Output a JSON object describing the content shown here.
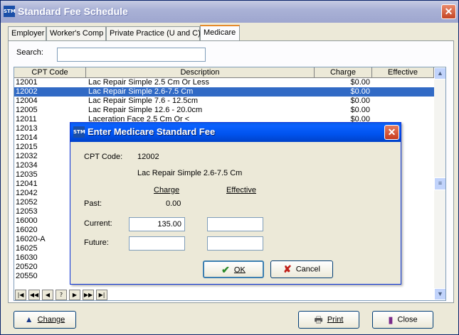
{
  "window": {
    "title": "Standard Fee Schedule"
  },
  "tabs": [
    {
      "label": "Employer"
    },
    {
      "label": "Worker's Comp"
    },
    {
      "label": "Private Practice (U and C)"
    },
    {
      "label": "Medicare"
    }
  ],
  "search": {
    "label": "Search:",
    "value": ""
  },
  "grid": {
    "columns": [
      "CPT Code",
      "Description",
      "Charge",
      "Effective"
    ],
    "rows": [
      {
        "code": "12001",
        "desc": "Lac Repair Simple 2.5 Cm Or Less",
        "charge": "$0.00",
        "effective": ""
      },
      {
        "code": "12002",
        "desc": "Lac Repair Simple 2.6-7.5 Cm",
        "charge": "$0.00",
        "effective": ""
      },
      {
        "code": "12004",
        "desc": "Lac Repair Simple 7.6 - 12.5cm",
        "charge": "$0.00",
        "effective": ""
      },
      {
        "code": "12005",
        "desc": "Lac Repair Simple 12.6 - 20.0cm",
        "charge": "$0.00",
        "effective": ""
      },
      {
        "code": "12011",
        "desc": "Laceration Face 2.5 Cm Or <",
        "charge": "$0.00",
        "effective": ""
      },
      {
        "code": "12013",
        "desc": "",
        "charge": "",
        "effective": ""
      },
      {
        "code": "12014",
        "desc": "",
        "charge": "",
        "effective": ""
      },
      {
        "code": "12015",
        "desc": "",
        "charge": "",
        "effective": ""
      },
      {
        "code": "12032",
        "desc": "",
        "charge": "",
        "effective": ""
      },
      {
        "code": "12034",
        "desc": "",
        "charge": "",
        "effective": ""
      },
      {
        "code": "12035",
        "desc": "",
        "charge": "",
        "effective": ""
      },
      {
        "code": "12041",
        "desc": "",
        "charge": "",
        "effective": ""
      },
      {
        "code": "12042",
        "desc": "",
        "charge": "",
        "effective": ""
      },
      {
        "code": "12052",
        "desc": "",
        "charge": "",
        "effective": ""
      },
      {
        "code": "12053",
        "desc": "",
        "charge": "",
        "effective": ""
      },
      {
        "code": "16000",
        "desc": "",
        "charge": "",
        "effective": ""
      },
      {
        "code": "16020",
        "desc": "",
        "charge": "",
        "effective": ""
      },
      {
        "code": "16020-A",
        "desc": "",
        "charge": "",
        "effective": ""
      },
      {
        "code": "16025",
        "desc": "",
        "charge": "",
        "effective": ""
      },
      {
        "code": "16030",
        "desc": "",
        "charge": "",
        "effective": ""
      },
      {
        "code": "20520",
        "desc": "",
        "charge": "",
        "effective": ""
      },
      {
        "code": "20550",
        "desc": "",
        "charge": "",
        "effective": ""
      }
    ],
    "selected_index": 1
  },
  "nav": [
    "|◀",
    "◀◀",
    "◀",
    "?",
    "▶",
    "▶▶",
    "▶|"
  ],
  "buttons": {
    "change": "Change",
    "print": "Print",
    "close": "Close"
  },
  "dialog": {
    "title": "Enter Medicare Standard Fee",
    "cpt_label": "CPT Code:",
    "cpt_value": "12002",
    "description": "Lac Repair Simple 2.6-7.5 Cm",
    "charge_header": "Charge",
    "effective_header": "Effective",
    "past_label": "Past:",
    "past_value": "0.00",
    "current_label": "Current:",
    "current_charge": "135.00",
    "current_effective": "",
    "future_label": "Future:",
    "future_charge": "",
    "future_effective": "",
    "ok_label": "OK",
    "cancel_label": "Cancel"
  },
  "colors": {
    "selection": "#316ac5",
    "title_active": "#0053ee",
    "title_inactive": "#9ea6cf"
  }
}
